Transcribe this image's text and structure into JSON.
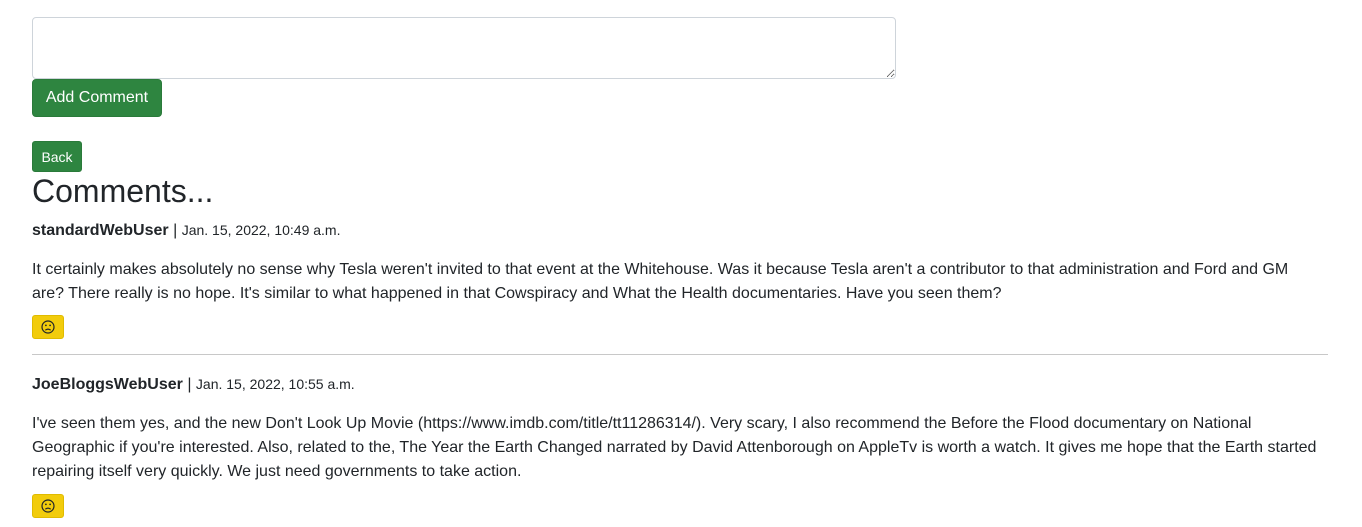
{
  "form": {
    "comment_value": "",
    "add_button_label": "Add Comment"
  },
  "nav": {
    "back_label": "Back"
  },
  "section": {
    "heading": "Comments..."
  },
  "comments": [
    {
      "author": "standardWebUser",
      "separator": "|",
      "date": "Jan. 15, 2022, 10:49 a.m.",
      "text": "It certainly makes absolutely no sense why Tesla weren't invited to that event at the Whitehouse. Was it because Tesla aren't a contributor to that administration and Ford and GM are? There really is no hope. It's similar to what happened in that Cowspiracy and What the Health documentaries. Have you seen them?",
      "reaction_icon": "sad-face-icon"
    },
    {
      "author": "JoeBloggsWebUser",
      "separator": "|",
      "date": "Jan. 15, 2022, 10:55 a.m.",
      "text": "I've seen them yes, and the new Don't Look Up Movie (https://www.imdb.com/title/tt11286314/). Very scary, I also recommend the Before the Flood documentary on National Geographic if you're interested. Also, related to the, The Year the Earth Changed narrated by David Attenborough on AppleTv is worth a watch. It gives me hope that the Earth started repairing itself very quickly. We just need governments to take action.",
      "reaction_icon": "sad-face-icon"
    }
  ],
  "colors": {
    "button_green": "#2e8540",
    "reaction_yellow": "#f2cc0c",
    "divider": "#c8c8c8"
  }
}
